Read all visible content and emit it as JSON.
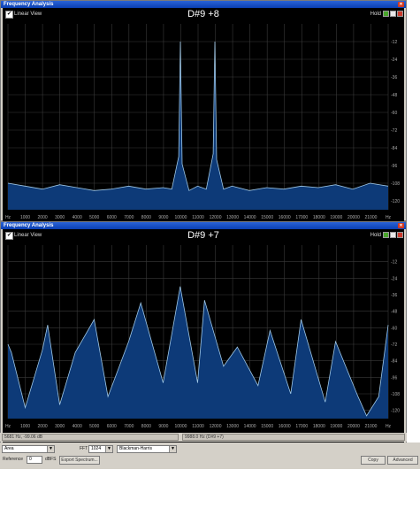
{
  "top_window": {
    "title": "Frequency Analysis",
    "linear_view_label": "Linear View",
    "note": "D#9 +8",
    "hold_label": "Hold"
  },
  "bottom_window": {
    "title": "Frequency Analysis",
    "linear_view_label": "Linear View",
    "note": "D#9 +7",
    "hold_label": "Hold"
  },
  "status": {
    "cursor_readout": "5681 Hz, -99.06 dB",
    "peak_readout": "9988.0 Hz (D#9 +7)"
  },
  "controls": {
    "mode_value": "Area",
    "fft_size_label": "FFT Size",
    "fft_size_value": "1024",
    "window_value": "Blackman-Harris",
    "reference_label": "Reference",
    "reference_value": "0",
    "reference_unit": "dBFS",
    "export_label": "Export Spectrum...",
    "copy_label": "Copy",
    "advanced_label": "Advanced"
  },
  "colors": {
    "fill": "#0d3a78",
    "outline": "#9ec7e6",
    "grid": "#3a3a3a",
    "background": "#000000",
    "title_bar": "#0a3fb2"
  },
  "chart_data": [
    {
      "type": "area",
      "title": "D#9 +8",
      "x_ticks": [
        "Hz",
        "1000",
        "2000",
        "3000",
        "4000",
        "5000",
        "6000",
        "7000",
        "8000",
        "9000",
        "10000",
        "11000",
        "12000",
        "13000",
        "14000",
        "15000",
        "16000",
        "17000",
        "18000",
        "19000",
        "20000",
        "21000",
        "Hz"
      ],
      "y_ticks": [
        "-12",
        "-24",
        "-36",
        "-48",
        "-60",
        "-72",
        "-84",
        "-96",
        "-108",
        "-120"
      ],
      "x_range": [
        0,
        22050
      ],
      "y_range": [
        -126,
        0
      ],
      "series": [
        {
          "x": [
            0,
            1000,
            2000,
            3000,
            4000,
            5000,
            6000,
            7000,
            8000,
            9000,
            9500,
            9900,
            10000,
            10100,
            10500,
            11000,
            11500,
            11900,
            12000,
            12100,
            12500,
            13000,
            14000,
            15000,
            16000,
            17000,
            18000,
            19000,
            20000,
            21000,
            22050
          ],
          "y": [
            -108,
            -110,
            -112,
            -109,
            -111,
            -113,
            -112,
            -110,
            -112,
            -111,
            -112,
            -90,
            -12,
            -95,
            -113,
            -110,
            -112,
            -88,
            -12,
            -92,
            -112,
            -110,
            -113,
            -111,
            -112,
            -110,
            -111,
            -109,
            -112,
            -108,
            -110
          ]
        }
      ]
    },
    {
      "type": "area",
      "title": "D#9 +7",
      "x_ticks": [
        "Hz",
        "1000",
        "2000",
        "3000",
        "4000",
        "5000",
        "6000",
        "7000",
        "8000",
        "9000",
        "10000",
        "11000",
        "12000",
        "13000",
        "14000",
        "15000",
        "16000",
        "17000",
        "18000",
        "19000",
        "20000",
        "21000",
        "Hz"
      ],
      "y_ticks": [
        "-12",
        "-24",
        "-36",
        "-48",
        "-60",
        "-72",
        "-84",
        "-96",
        "-108",
        "-120"
      ],
      "x_range": [
        0,
        22050
      ],
      "y_range": [
        -126,
        0
      ],
      "series": [
        {
          "x": [
            0,
            200,
            1000,
            2000,
            2300,
            3000,
            3900,
            5000,
            5800,
            7000,
            7700,
            9000,
            9988,
            11000,
            11400,
            12500,
            13300,
            14500,
            15200,
            16400,
            17000,
            18400,
            19000,
            20300,
            20800,
            21500,
            22050
          ],
          "y": [
            -72,
            -78,
            -118,
            -76,
            -58,
            -116,
            -78,
            -54,
            -110,
            -70,
            -42,
            -100,
            -30,
            -100,
            -40,
            -88,
            -74,
            -102,
            -62,
            -108,
            -54,
            -114,
            -70,
            -110,
            -124,
            -110,
            -58
          ]
        }
      ]
    }
  ]
}
